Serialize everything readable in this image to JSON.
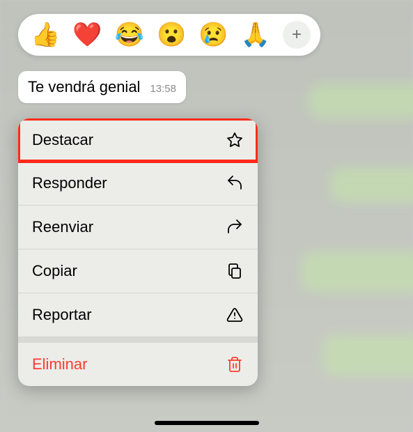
{
  "reactions": {
    "emojis": [
      "👍",
      "❤️",
      "😂",
      "😮",
      "😢",
      "🙏"
    ],
    "add_label": "+"
  },
  "message": {
    "text": "Te vendrá genial",
    "time": "13:58"
  },
  "menu": {
    "destacar": "Destacar",
    "responder": "Responder",
    "reenviar": "Reenviar",
    "copiar": "Copiar",
    "reportar": "Reportar",
    "eliminar": "Eliminar"
  }
}
